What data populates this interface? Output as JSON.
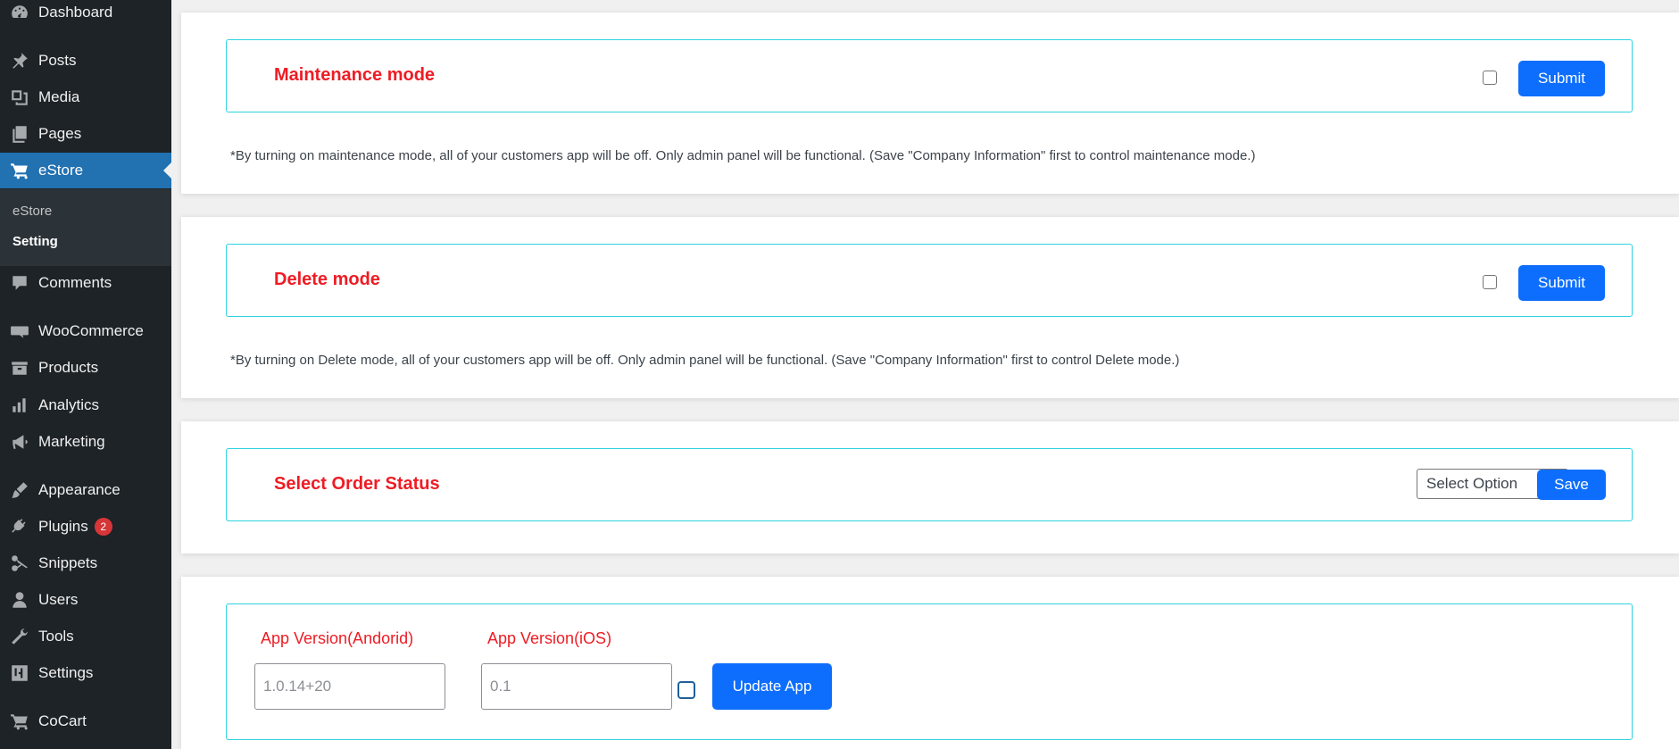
{
  "sidebar": {
    "items": [
      {
        "label": "Dashboard",
        "icon": "dashboard-icon"
      },
      {
        "label": "Posts",
        "icon": "pin-icon"
      },
      {
        "label": "Media",
        "icon": "media-icon"
      },
      {
        "label": "Pages",
        "icon": "pages-icon"
      },
      {
        "label": "eStore",
        "icon": "cart-icon"
      },
      {
        "label": "Comments",
        "icon": "comment-icon"
      },
      {
        "label": "WooCommerce",
        "icon": "woo-icon"
      },
      {
        "label": "Products",
        "icon": "archive-icon"
      },
      {
        "label": "Analytics",
        "icon": "chart-bar-icon"
      },
      {
        "label": "Marketing",
        "icon": "megaphone-icon"
      },
      {
        "label": "Appearance",
        "icon": "brush-icon"
      },
      {
        "label": "Plugins",
        "icon": "plugin-icon",
        "badge": "2"
      },
      {
        "label": "Snippets",
        "icon": "scissors-icon"
      },
      {
        "label": "Users",
        "icon": "user-icon"
      },
      {
        "label": "Tools",
        "icon": "wrench-icon"
      },
      {
        "label": "Settings",
        "icon": "sliders-icon"
      },
      {
        "label": "CoCart",
        "icon": "cart-icon"
      }
    ],
    "submenu": [
      {
        "label": "eStore"
      },
      {
        "label": "Setting"
      }
    ]
  },
  "maintenance": {
    "title": "Maintenance mode",
    "button": "Submit",
    "note": "*By turning on maintenance mode, all of your customers app will be off. Only admin panel will be functional. (Save \"Company Information\" first to control maintenance mode.)"
  },
  "delete_mode": {
    "title": "Delete mode",
    "button": "Submit",
    "note": "*By turning on Delete mode, all of your customers app will be off. Only admin panel will be functional. (Save \"Company Information\" first to control Delete mode.)"
  },
  "order_status": {
    "title": "Select Order Status",
    "select_value": "Select Option",
    "button": "Save"
  },
  "app_version": {
    "android_label": "App Version(Andorid)",
    "android_value": "1.0.14+20",
    "ios_label": "App Version(iOS)",
    "ios_value": "0.1",
    "button": "Update App"
  },
  "colors": {
    "sidebar_bg": "#1d2327",
    "active_bg": "#2271b1",
    "accent_red": "#ee1c24",
    "button_blue": "#0d6efd",
    "border_cyan": "#2fd3e0"
  }
}
